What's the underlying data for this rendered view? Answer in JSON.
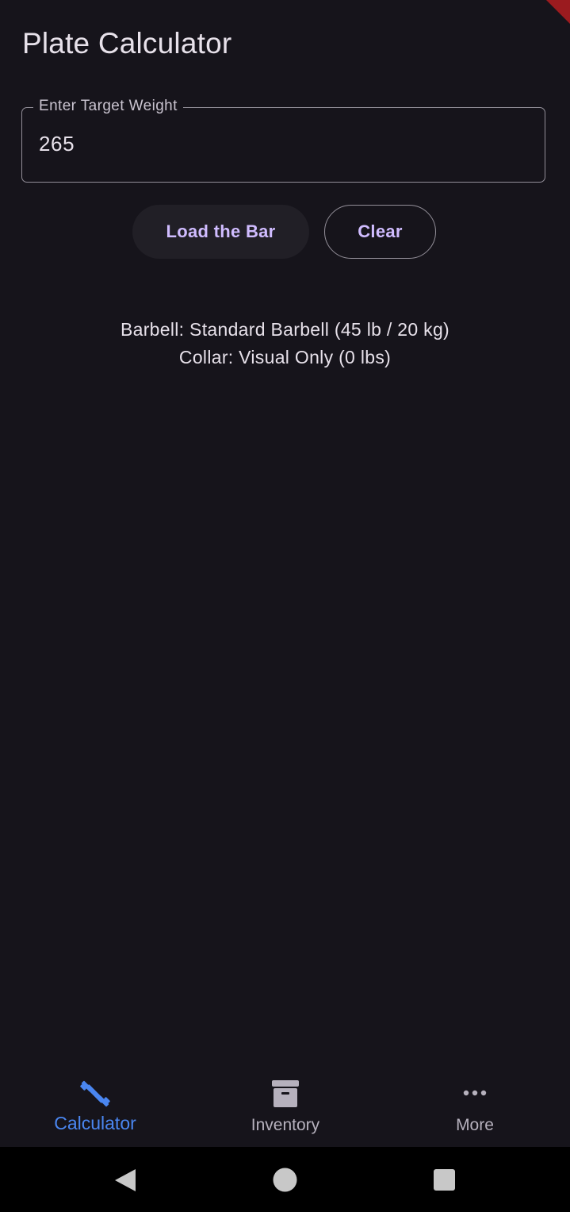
{
  "app": {
    "title": "Plate Calculator"
  },
  "weight_field": {
    "label": "Enter Target Weight",
    "value": "265"
  },
  "actions": {
    "load_label": "Load the Bar",
    "clear_label": "Clear"
  },
  "info": {
    "barbell": "Barbell: Standard Barbell (45 lb / 20 kg)",
    "collar": "Collar: Visual Only (0 lbs)"
  },
  "bottom_nav": {
    "items": [
      {
        "label": "Calculator",
        "icon": "barbell-icon",
        "active": true
      },
      {
        "label": "Inventory",
        "icon": "archive-box-icon",
        "active": false
      },
      {
        "label": "More",
        "icon": "more-dots-icon",
        "active": false
      }
    ]
  },
  "system_nav": {
    "back_icon": "back-triangle-icon",
    "home_icon": "home-circle-icon",
    "recents_icon": "recents-square-icon"
  },
  "colors": {
    "background": "#16141b",
    "accent_text": "#d0bcff",
    "active_nav": "#4a86f0",
    "debug_banner": "#9b1b1f"
  }
}
